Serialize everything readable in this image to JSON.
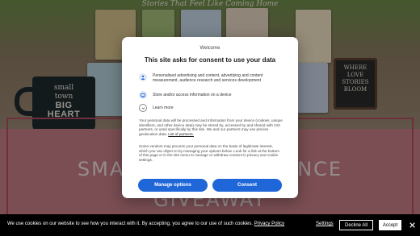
{
  "background": {
    "tagline": "Stories That Feel Like Coming Home",
    "mug_lines": [
      "small",
      "town",
      "BIG",
      "HEART"
    ],
    "sign_lines": [
      "WHERE",
      "LOVE",
      "STORIES",
      "BLOOM"
    ],
    "headline_1": "SMALL TOWN ROMANCE",
    "headline_2": "GIVEAWAY",
    "colors": {
      "pink_panel": "#c67f86",
      "frame": "#b14e62"
    }
  },
  "dialog": {
    "welcome": "Welcome",
    "title": "This site asks for consent to use your data",
    "purposes": [
      {
        "icon": "person-icon",
        "text": "Personalised advertising and content, advertising and content measurement, audience research and services development"
      },
      {
        "icon": "device-storage-icon",
        "text": "Store and/or access information on a device"
      }
    ],
    "learn_more": "Learn more",
    "paragraph_1": "Your personal data will be processed and information from your device (cookies, unique identifiers, and other device data) may be stored by, accessed by and shared with 210 partners, or used specifically by this site. We and our partners may use precise geolocation data.",
    "partners_link": "List of partners.",
    "paragraph_2": "Some vendors may process your personal data on the basis of legitimate interest, which you can object to by managing your options below. Look for a link at the bottom of this page or in the site menu to manage or withdraw consent in privacy and cookie settings.",
    "manage_label": "Manage options",
    "consent_label": "Consent",
    "accent": "#1f67d9"
  },
  "cookie_bar": {
    "text": "We use cookies on our website to see how you interact with it. By accepting, you agree to our use of such cookies.",
    "privacy_link": "Privacy Policy",
    "settings_label": "Settings",
    "decline_label": "Decline All",
    "accept_label": "Accept"
  }
}
